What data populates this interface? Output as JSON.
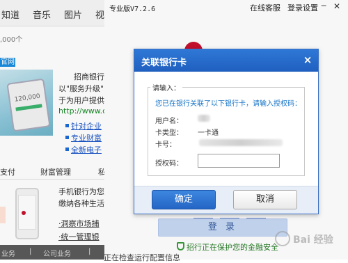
{
  "webpage": {
    "nav": [
      "知道",
      "音乐",
      "图片",
      "视"
    ],
    "result_count": ",000个",
    "site_tag": "官网",
    "ad_phone_text": "120,000",
    "description_lines": [
      "招商银行",
      "以\"服务升级\"",
      "于为用户提供",
      "http://www.cn"
    ],
    "bullet_links": [
      "针对企业",
      "专业财富",
      "全新电子"
    ],
    "tabs": [
      "支付",
      "财富管理",
      "私"
    ],
    "mobile_lines": [
      "手机银行为您",
      "缴纳各种生活"
    ],
    "mobile_links": [
      "·洞察市场捕",
      "·统一管理银"
    ],
    "bottom_bar": [
      "业务",
      "公司业务",
      "|"
    ]
  },
  "login_window": {
    "version": "专业版V7.2.6",
    "online_support": "在线客服",
    "login_settings": "登录设置",
    "minimize": "─",
    "close": "✕",
    "login_button": "登 录",
    "security_notice": "招行正在保护您的金融安全",
    "footer_text": "正在检查运行配置信息"
  },
  "dialog": {
    "title": "关联银行卡",
    "close_icon": "×",
    "legend": "请输入：",
    "instruction": "您已在银行关联了以下银行卡，请输入授权码：",
    "fields": [
      {
        "label": "用户名：",
        "value": ""
      },
      {
        "label": "卡类型：",
        "value": "一卡通"
      },
      {
        "label": "卡号：",
        "value": ""
      }
    ],
    "auth_label": "授权码：",
    "auth_value": "",
    "confirm": "确定",
    "cancel": "取消"
  },
  "watermark": "Bai 经验",
  "colors": {
    "header_blue": "#2f78d6",
    "confirm_blue": "#2465c4",
    "instruction_blue": "#1a76c8",
    "security_green": "#2a7d2a",
    "bank_red": "#c8102e"
  },
  "icons": [
    "close-icon",
    "shield-icon",
    "bank-logo",
    "minimize-icon"
  ]
}
